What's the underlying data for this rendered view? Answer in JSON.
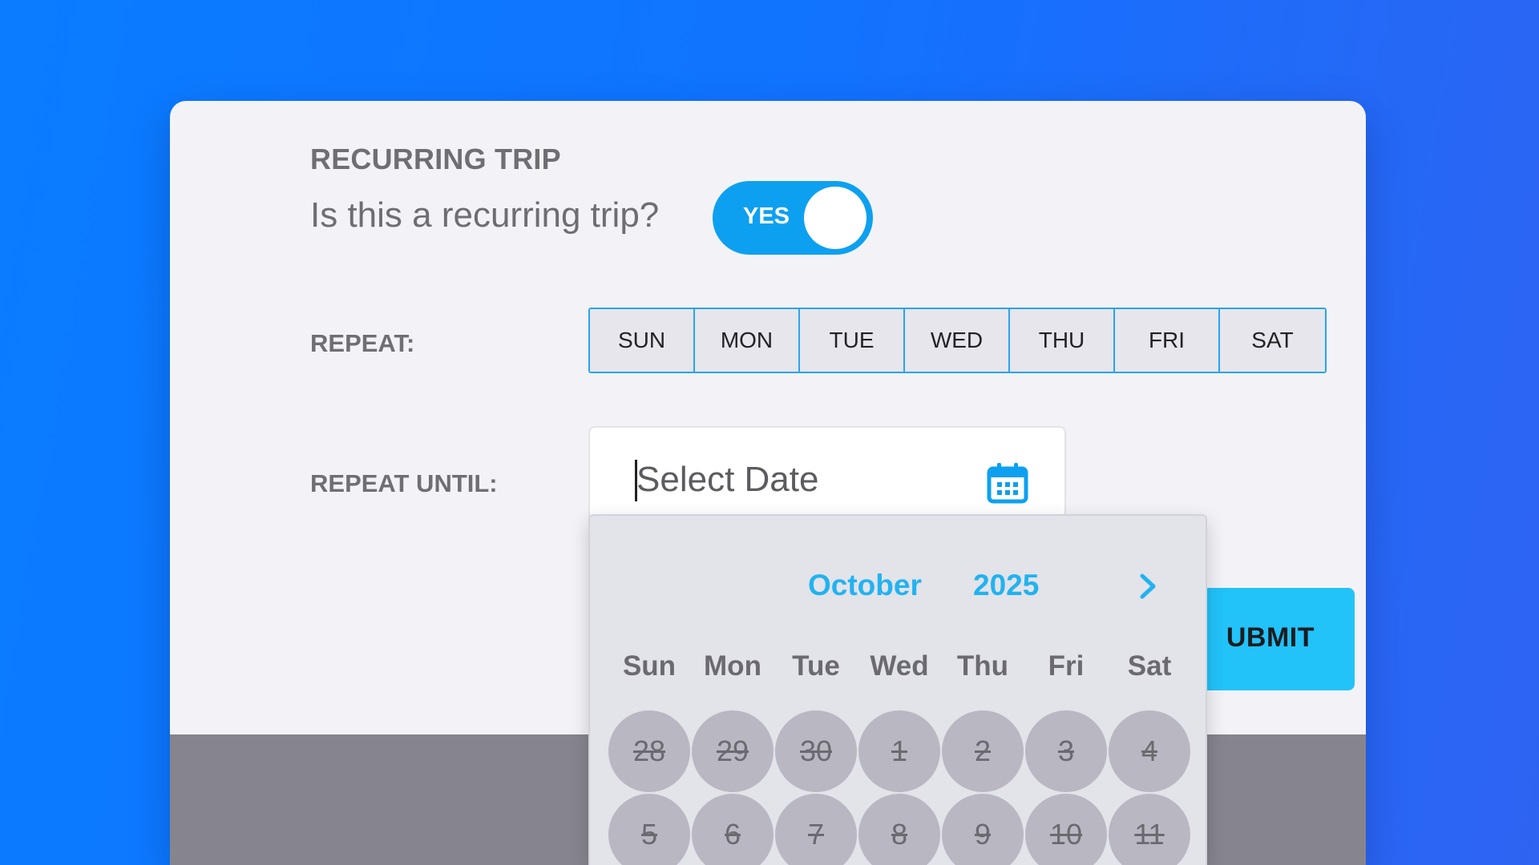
{
  "recurring": {
    "title": "RECURRING TRIP",
    "question": "Is this a recurring trip?",
    "toggle_label": "YES",
    "toggle_on": true
  },
  "repeat": {
    "label": "REPEAT:",
    "days": [
      "SUN",
      "MON",
      "TUE",
      "WED",
      "THU",
      "FRI",
      "SAT"
    ]
  },
  "repeat_until": {
    "label": "REPEAT UNTIL:",
    "placeholder": "Select Date",
    "icon": "calendar-icon"
  },
  "submit": {
    "label": "UBMIT"
  },
  "datepicker": {
    "month": "October",
    "year": "2025",
    "next_icon": "chevron-right-icon",
    "weekdays": [
      "Sun",
      "Mon",
      "Tue",
      "Wed",
      "Thu",
      "Fri",
      "Sat"
    ],
    "weeks": [
      [
        "28",
        "29",
        "30",
        "1",
        "2",
        "3",
        "4"
      ],
      [
        "5",
        "6",
        "7",
        "8",
        "9",
        "10",
        "11"
      ]
    ],
    "disabled": true
  },
  "colors": {
    "background_start": "#0a7cff",
    "background_end": "#2f63f2",
    "accent": "#0ea0f0",
    "datepicker_accent": "#22b3ef",
    "submit": "#21c3f9"
  }
}
